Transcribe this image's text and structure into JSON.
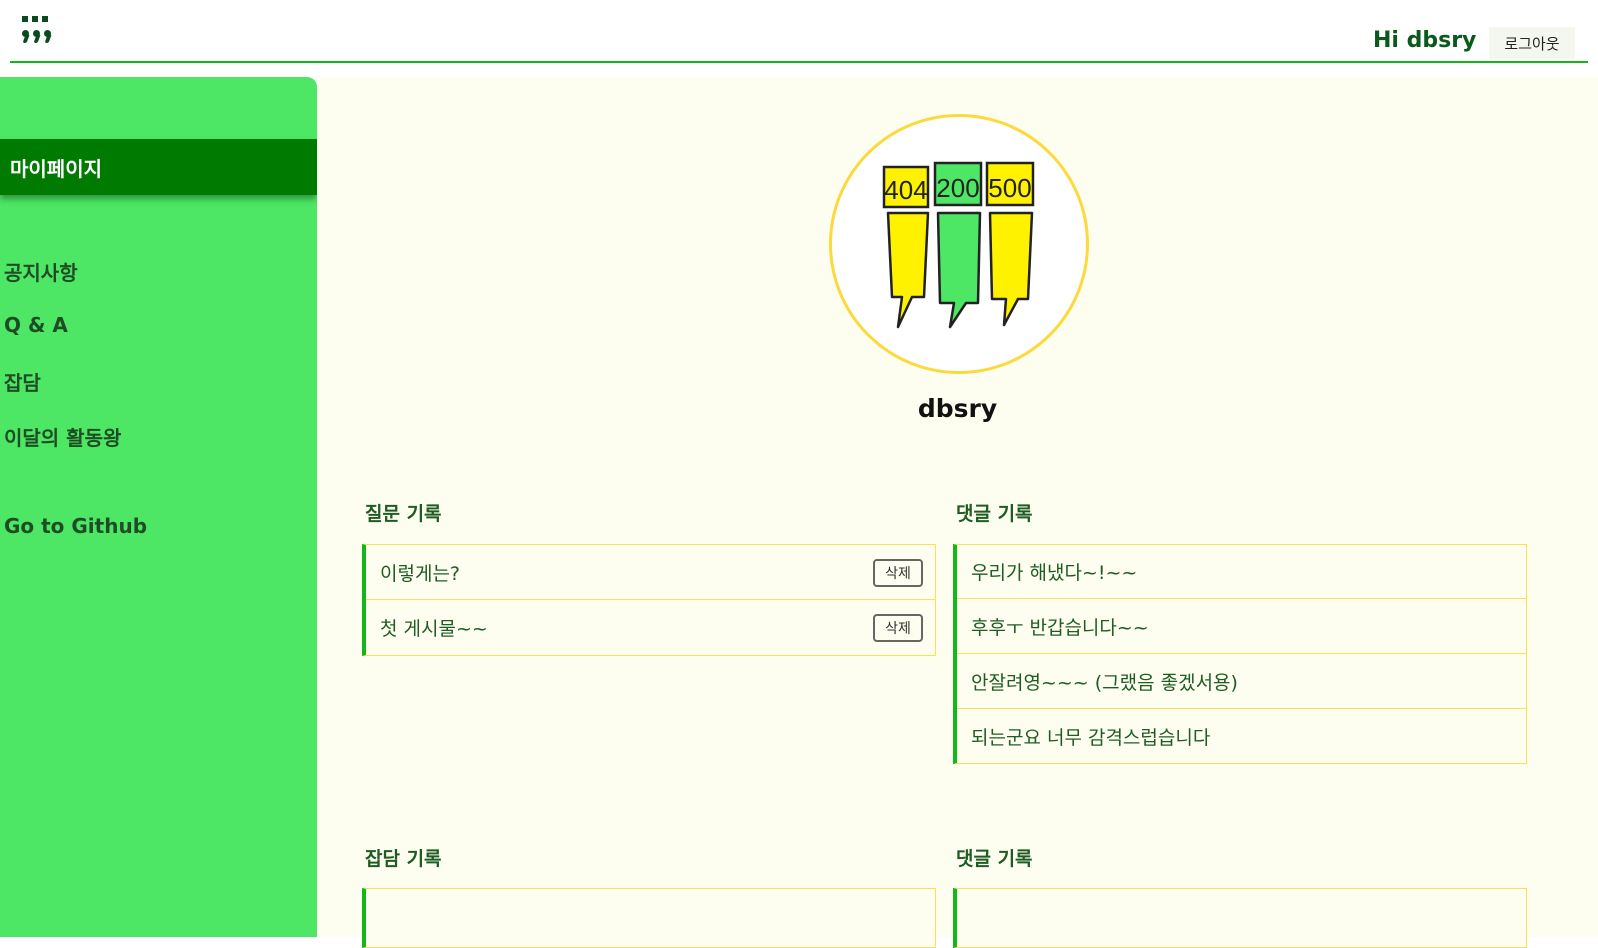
{
  "header": {
    "greeting": "Hi dbsry",
    "logout_label": "로그아웃",
    "logo_icon": "quote-comma-logo-icon",
    "accent": "#12b81a"
  },
  "sidebar": {
    "active_item": "마이페이지",
    "items": [
      "공지사항",
      "Q & A",
      "잡담",
      "이달의 활동왕"
    ],
    "github_link": "Go to Github",
    "bg_color": "#4de665",
    "active_color": "#007a00"
  },
  "profile": {
    "username": "dbsry",
    "avatar_signs": [
      "404",
      "200",
      "500"
    ]
  },
  "sections": {
    "questions": {
      "title": "질문 기록",
      "items": [
        {
          "text": "이렇게는?",
          "delete_label": "삭제"
        },
        {
          "text": "첫 게시물~~",
          "delete_label": "삭제"
        }
      ]
    },
    "question_comments": {
      "title": "댓글 기록",
      "items": [
        "우리가 해냈다~!~~",
        "후후ㅜ 반갑습니다~~",
        "안잘려영~~~ (그랬음 좋겠서용)",
        "되는군요 너무 감격스럽습니다"
      ]
    },
    "chats": {
      "title": "잡담 기록"
    },
    "chat_comments": {
      "title": "댓글 기록"
    }
  }
}
